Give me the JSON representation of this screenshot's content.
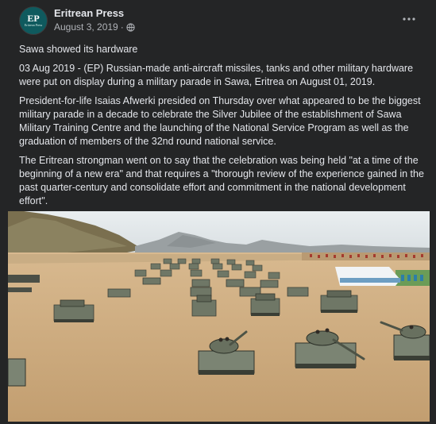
{
  "post": {
    "page_name": "Eritrean Press",
    "avatar_text": "EP",
    "avatar_subtext": "Eritrean Press",
    "date": "August 3, 2019",
    "separator": "·",
    "privacy_icon": "globe-icon",
    "more_icon": "more-horizontal-icon",
    "paragraphs": [
      "Sawa showed its hardware",
      "03 Aug 2019 - (EP) Russian-made anti-aircraft missiles, tanks and other military hardware were put on display during a military parade in Sawa, Eritrea on August 01, 2019.",
      "President-for-life Isaias Afwerki presided on Thursday over what appeared to be the biggest military parade in a decade to celebrate the Silver Jubilee of the establishment of Sawa Military Training Centre and the launching of the National Service Program as well as the graduation of members of the 32nd round national service.",
      "The Eritrean strongman went on to say that the celebration was being held \"at a time of the beginning of a new era\" and that requires a \"thorough review of the experience gained in the past quarter-century and consolidate effort and commitment in the national development effort\"."
    ]
  },
  "colors": {
    "page_background": "#18191a",
    "card_background": "#242526",
    "primary_text": "#e4e6eb",
    "secondary_text": "#b0b3b8",
    "avatar_background": "#0f5a5e",
    "sky": "#dfe5e8",
    "ground": "#c9a77a",
    "tank": "#6f7766"
  }
}
